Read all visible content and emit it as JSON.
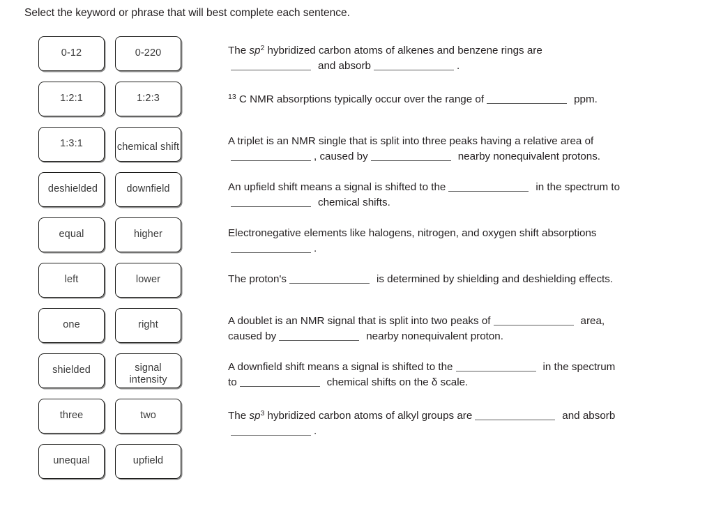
{
  "instruction": "Select the keyword or phrase that will best complete each sentence.",
  "keyword_bank": {
    "rows": [
      {
        "left": "0-12",
        "right": "0-220"
      },
      {
        "left": "1:2:1",
        "right": "1:2:3"
      },
      {
        "left": "1:3:1",
        "right": "chemical shift"
      },
      {
        "left": "deshielded",
        "right": "downfield"
      },
      {
        "left": "equal",
        "right": "higher"
      },
      {
        "left": "left",
        "right": "lower"
      },
      {
        "left": "one",
        "right": "right"
      },
      {
        "left": "shielded",
        "right": "signal intensity"
      },
      {
        "left": "three",
        "right": "two"
      },
      {
        "left": "unequal",
        "right": "upfield"
      }
    ]
  },
  "questions": [
    {
      "id": "q1",
      "text": "The sp² hybridized carbon atoms of alkenes and benzene rings are ______________ and absorb ______________ .",
      "parts": {
        "a": "The ",
        "italic": "sp",
        "superscript": "2",
        "b": " hybridized carbon atoms of alkenes and benzene rings are",
        "c": "and absorb",
        "d": "."
      }
    },
    {
      "id": "q2",
      "text": "¹³ C NMR absorptions typically occur over the range of ______________ ppm.",
      "parts": {
        "superscript": "13",
        "a": " C NMR absorptions typically occur over the range of",
        "b": "ppm."
      }
    },
    {
      "id": "q3",
      "text": "A triplet is an NMR single that is split into three peaks having a relative area of ______________ , caused by ______________ nearby nonequivalent protons.",
      "parts": {
        "a": "A triplet is an NMR single that is split into three peaks having a relative area of",
        "b": ", caused by",
        "c": "nearby nonequivalent protons."
      }
    },
    {
      "id": "q4",
      "text": "An upfield shift means a signal is shifted to the ______________ in the spectrum to ______________ chemical shifts.",
      "parts": {
        "a": "An upfield shift means a signal is shifted to the",
        "b": "in the spectrum to",
        "c": "chemical shifts."
      }
    },
    {
      "id": "q5",
      "text": "Electronegative elements like halogens, nitrogen, and oxygen shift absorptions ______________ .",
      "parts": {
        "a": "Electronegative elements like halogens, nitrogen, and oxygen shift absorptions",
        "b": "."
      }
    },
    {
      "id": "q6",
      "text": "The proton's ______________ is determined by shielding and deshielding effects.",
      "parts": {
        "a": "The proton's",
        "b": "is determined by shielding and deshielding effects."
      }
    },
    {
      "id": "q7",
      "text": "A doublet is an NMR signal that is split into two peaks of ______________ area, caused by ______________ nearby nonequivalent proton.",
      "parts": {
        "a": "A doublet is an NMR signal that is split into two peaks of",
        "b": "area,",
        "c": "caused by",
        "d": "nearby nonequivalent proton."
      }
    },
    {
      "id": "q8",
      "text": "A downfield shift means a signal is shifted to the ______________ in the spectrum to ______________ chemical shifts on the δ scale.",
      "parts": {
        "a": "A downfield shift means a signal is shifted to the",
        "b": "in the spectrum",
        "c": "to",
        "d": "chemical shifts on the δ scale."
      }
    },
    {
      "id": "q9",
      "text": "The sp³ hybridized carbon atoms of alkyl groups are ______________ and absorb ______________ .",
      "parts": {
        "a": "The ",
        "italic": "sp",
        "superscript": "3",
        "b": " hybridized carbon atoms of alkyl groups are",
        "c": "and absorb",
        "d": "."
      }
    }
  ],
  "colors": {
    "background": "#ffffff",
    "text": "#231f20",
    "chip_border": "#1d1d1b",
    "chip_text": "#3a3a3a",
    "blank_line": "#5b5b5b"
  }
}
